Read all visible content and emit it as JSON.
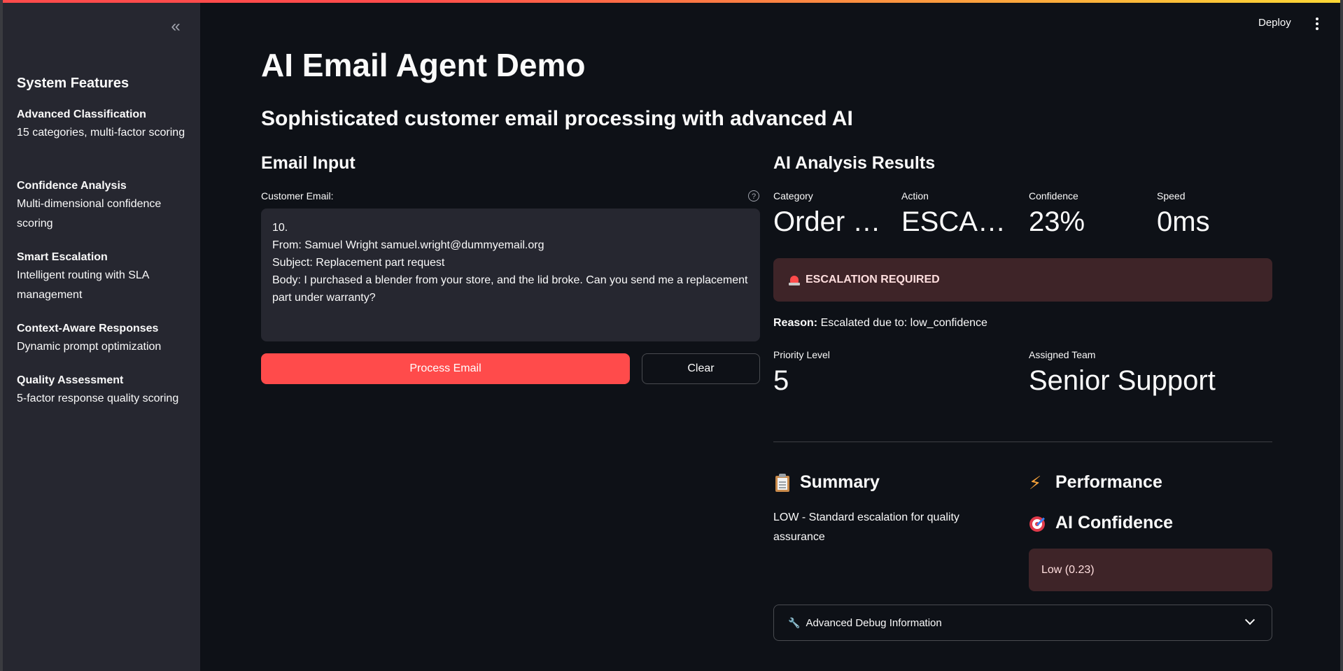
{
  "header": {
    "deploy_label": "Deploy"
  },
  "sidebar": {
    "title": "System Features",
    "features": [
      {
        "title": "Advanced Classification",
        "desc": "15 categories, multi-factor scoring"
      },
      {
        "title": "Confidence Analysis",
        "desc": "Multi-dimensional confidence scoring"
      },
      {
        "title": "Smart Escalation",
        "desc": "Intelligent routing with SLA management"
      },
      {
        "title": "Context-Aware Responses",
        "desc": "Dynamic prompt optimization"
      },
      {
        "title": "Quality Assessment",
        "desc": "5-factor response quality scoring"
      }
    ]
  },
  "main": {
    "title": "AI Email Agent Demo",
    "subtitle": "Sophisticated customer email processing with advanced AI"
  },
  "email_input": {
    "heading": "Email Input",
    "field_label": "Customer Email:",
    "value": "10.\nFrom: Samuel Wright samuel.wright@dummyemail.org\nSubject: Replacement part request\nBody: I purchased a blender from your store, and the lid broke. Can you send me a replacement part under warranty?",
    "process_button": "Process Email",
    "clear_button": "Clear"
  },
  "results": {
    "heading": "AI Analysis Results",
    "metrics": [
      {
        "label": "Category",
        "value": "Order S…"
      },
      {
        "label": "Action",
        "value": "ESCALA…"
      },
      {
        "label": "Confidence",
        "value": "23%"
      },
      {
        "label": "Speed",
        "value": "0ms"
      }
    ],
    "alert_text": "ESCALATION REQUIRED",
    "reason_label": "Reason:",
    "reason_text": " Escalated due to: low_confidence",
    "priority_label": "Priority Level",
    "priority_value": "5",
    "team_label": "Assigned Team",
    "team_value": "Senior Support",
    "summary_heading": "Summary",
    "summary_text": "LOW - Standard escalation for quality assurance",
    "performance_heading": "Performance",
    "ai_confidence_heading": "AI Confidence",
    "ai_confidence_value": "Low (0.23)",
    "debug_label": "Advanced Debug Information"
  },
  "colors": {
    "accent": "#ff4b4b",
    "background": "#0e1117",
    "sidebar": "#262730",
    "alert_bg": "#3e2428"
  },
  "icons": [
    "collapse-sidebar-icon",
    "kebab-menu-icon",
    "help-icon",
    "siren-icon",
    "clipboard-icon",
    "lightning-icon",
    "target-icon",
    "wrench-icon",
    "chevron-down-icon"
  ]
}
